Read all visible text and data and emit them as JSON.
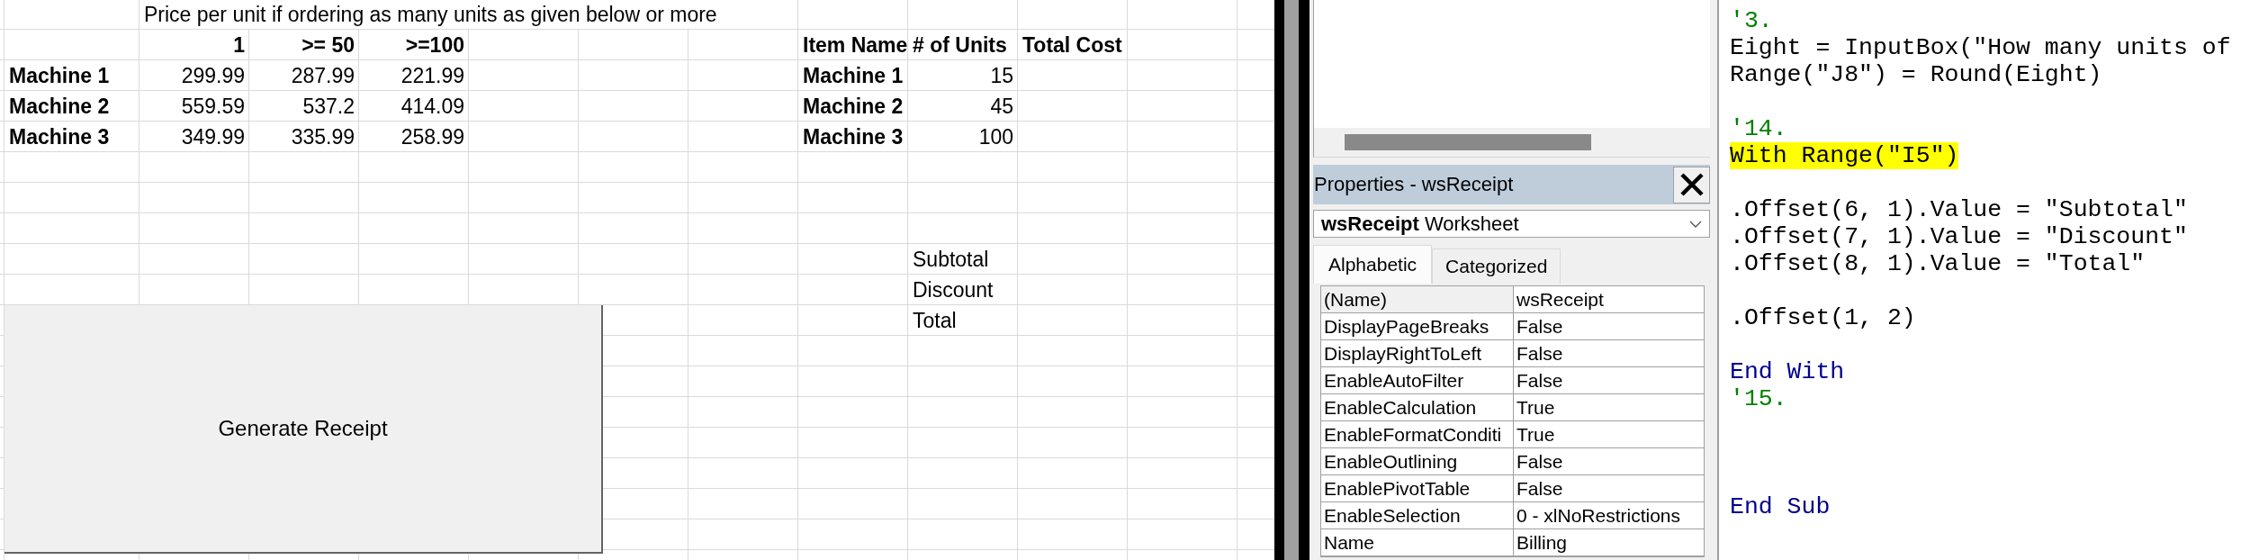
{
  "spreadsheet": {
    "price_table": {
      "title": "Price per unit if ordering as many units as given below or more",
      "columns": [
        "1",
        ">= 50",
        ">=100"
      ],
      "rows": [
        {
          "item": "Machine 1",
          "prices": [
            "299.99",
            "287.99",
            "221.99"
          ]
        },
        {
          "item": "Machine 2",
          "prices": [
            "559.59",
            "537.2",
            "414.09"
          ]
        },
        {
          "item": "Machine 3",
          "prices": [
            "349.99",
            "335.99",
            "258.99"
          ]
        }
      ]
    },
    "order_table": {
      "columns": [
        "Item Name",
        "# of Units",
        "Total Cost"
      ],
      "rows": [
        {
          "item": "Machine 1",
          "units": "15"
        },
        {
          "item": "Machine 2",
          "units": "45"
        },
        {
          "item": "Machine 3",
          "units": "100"
        }
      ]
    },
    "summary_labels": [
      "Subtotal",
      "Discount",
      "Total"
    ],
    "button": {
      "label": "Generate Receipt"
    }
  },
  "properties_window": {
    "title": "Properties - wsReceipt",
    "object_selector": {
      "value": "**wsReceipt** Worksheet"
    },
    "tabs": [
      {
        "label": "Alphabetic",
        "selected": true
      },
      {
        "label": "Categorized",
        "selected": false
      }
    ],
    "properties": [
      {
        "name": "(Name)",
        "value": "wsReceipt",
        "selected": true
      },
      {
        "name": "DisplayPageBreaks",
        "value": "False",
        "selected": false
      },
      {
        "name": "DisplayRightToLeft",
        "value": "False",
        "selected": false
      },
      {
        "name": "EnableAutoFilter",
        "value": "False",
        "selected": false
      },
      {
        "name": "EnableCalculation",
        "value": "True",
        "selected": false
      },
      {
        "name": "EnableFormatConditi",
        "value": "True",
        "selected": false
      },
      {
        "name": "EnableOutlining",
        "value": "False",
        "selected": false
      },
      {
        "name": "EnablePivotTable",
        "value": "False",
        "selected": false
      },
      {
        "name": "EnableSelection",
        "value": "0 - xlNoRestrictions",
        "selected": false
      },
      {
        "name": "Name",
        "value": "Billing",
        "selected": false
      }
    ]
  },
  "code_window": {
    "lines": [
      {
        "kind": "comment",
        "text": "'3.",
        "highlighted": false
      },
      {
        "kind": "code",
        "text": "Eight = InputBox(\"How many units of",
        "highlighted": false
      },
      {
        "kind": "code",
        "text": "Range(\"J8\") = Round(Eight)",
        "highlighted": false
      },
      {
        "kind": "blank",
        "highlighted": false
      },
      {
        "kind": "comment",
        "text": "'14.",
        "highlighted": false
      },
      {
        "kind": "code",
        "text": "With Range(\"I5\")",
        "highlighted": true
      },
      {
        "kind": "blank",
        "highlighted": false
      },
      {
        "kind": "code",
        "text": ".Offset(6, 1).Value = \"Subtotal\"",
        "highlighted": false
      },
      {
        "kind": "code",
        "text": ".Offset(7, 1).Value = \"Discount\"",
        "highlighted": false
      },
      {
        "kind": "code",
        "text": ".Offset(8, 1).Value = \"Total\"",
        "highlighted": false
      },
      {
        "kind": "blank",
        "highlighted": false
      },
      {
        "kind": "code",
        "text": ".Offset(1, 2)",
        "highlighted": false
      },
      {
        "kind": "blank",
        "highlighted": false
      },
      {
        "kind": "keyword",
        "text": "End With",
        "highlighted": false
      },
      {
        "kind": "comment",
        "text": "'15.",
        "highlighted": false
      },
      {
        "kind": "blank",
        "highlighted": false
      },
      {
        "kind": "blank",
        "highlighted": false
      },
      {
        "kind": "blank",
        "highlighted": false
      },
      {
        "kind": "keyword",
        "text": "End Sub",
        "highlighted": false
      }
    ]
  }
}
